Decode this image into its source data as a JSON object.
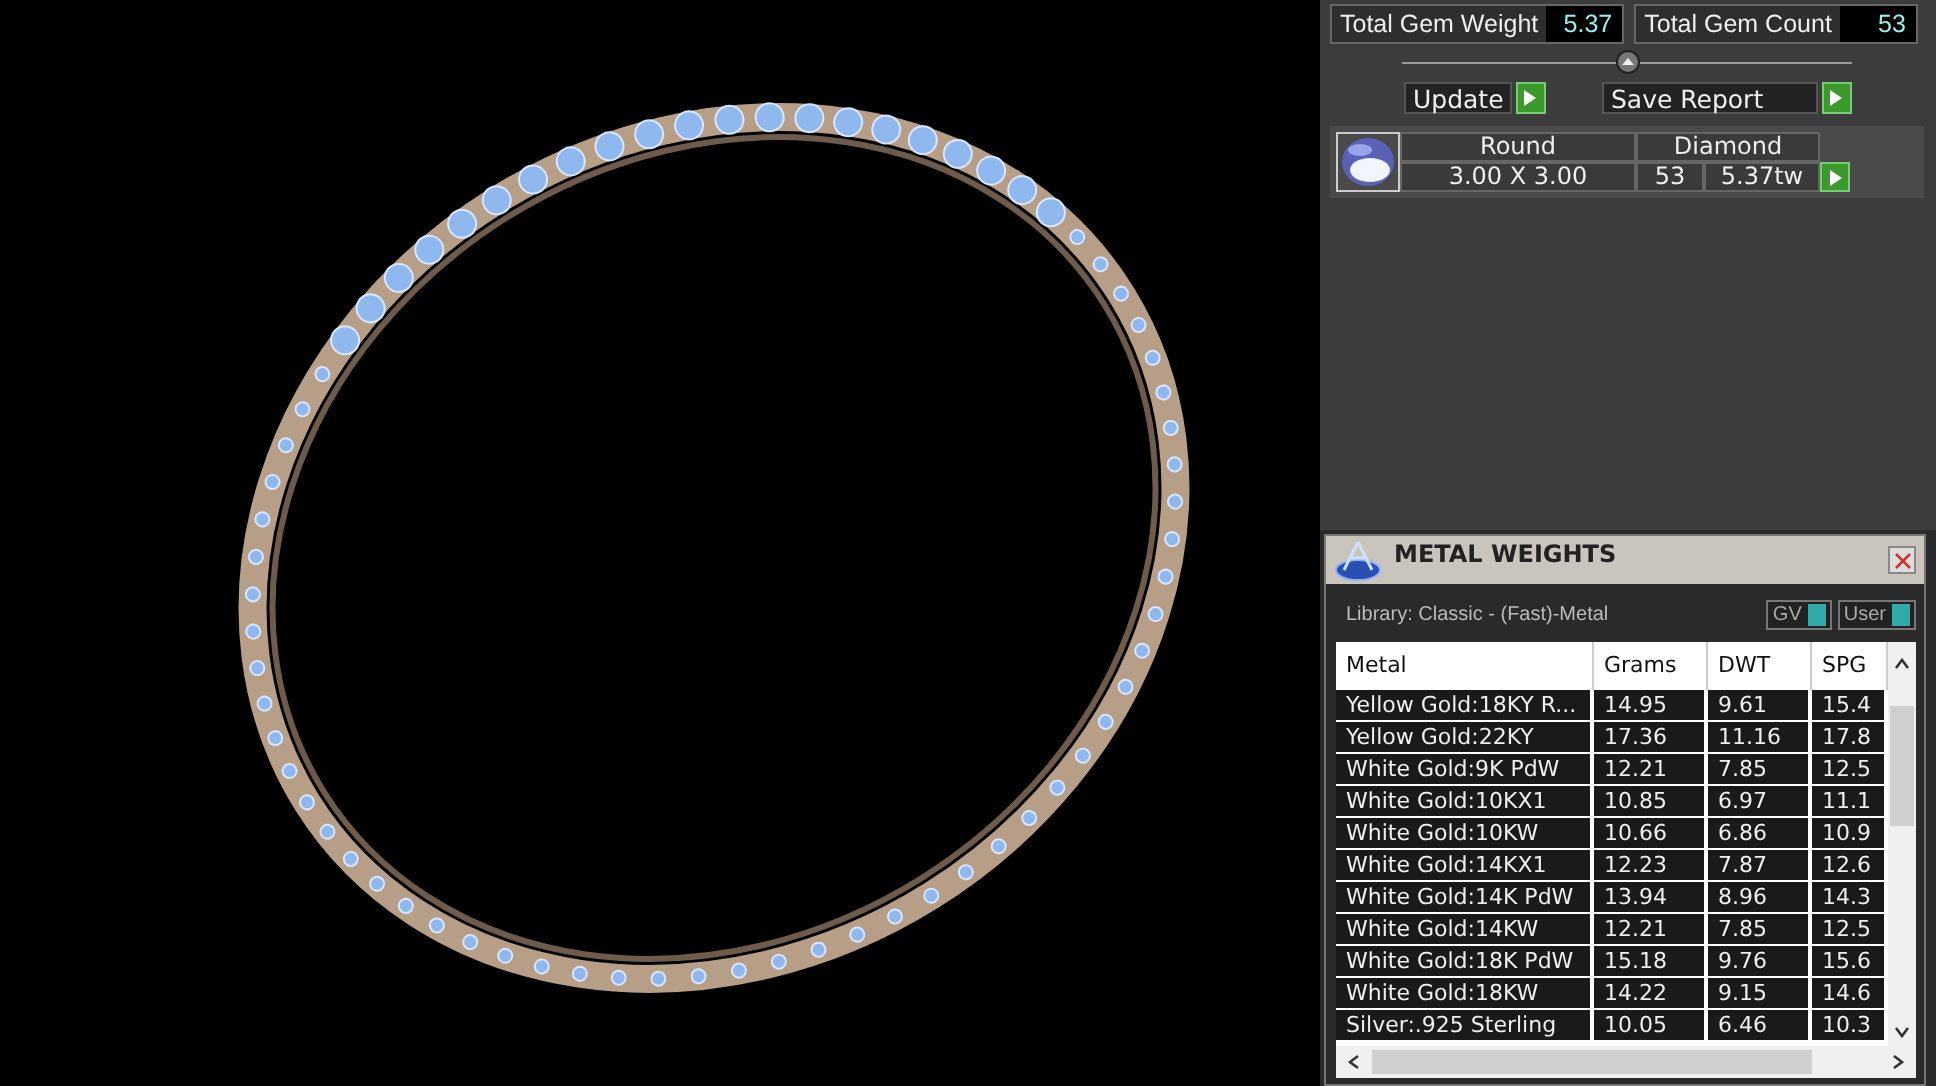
{
  "summary": [
    {
      "label": "Total Gem Weight",
      "value": "5.37"
    },
    {
      "label": "Total Gem Count",
      "value": "53"
    }
  ],
  "buttons": [
    {
      "label": "Update"
    },
    {
      "label": "Save Report"
    }
  ],
  "gem": {
    "shape": "Round",
    "type": "Diamond",
    "size": "3.00 X 3.00",
    "count": "53",
    "weight": "5.37tw"
  },
  "metal_weights": {
    "title": "METAL WEIGHTS",
    "library": "Library: Classic - (Fast)-Metal",
    "toggles": [
      {
        "label": "GV",
        "on": true
      },
      {
        "label": "User",
        "on": true
      }
    ],
    "columns": [
      "Metal",
      "Grams",
      "DWT",
      "SPG"
    ],
    "rows": [
      [
        "Yellow Gold:18KY R...",
        "14.95",
        "9.61",
        "15.4"
      ],
      [
        "Yellow Gold:22KY",
        "17.36",
        "11.16",
        "17.8"
      ],
      [
        "White Gold:9K PdW",
        "12.21",
        "7.85",
        "12.5"
      ],
      [
        "White Gold:10KX1",
        "10.85",
        "6.97",
        "11.1"
      ],
      [
        "White Gold:10KW",
        "10.66",
        "6.86",
        "10.9"
      ],
      [
        "White Gold:14KX1",
        "12.23",
        "7.87",
        "12.6"
      ],
      [
        "White Gold:14K PdW",
        "13.94",
        "8.96",
        "14.3"
      ],
      [
        "White Gold:14KW",
        "12.21",
        "7.85",
        "12.5"
      ],
      [
        "White Gold:18K PdW",
        "15.18",
        "9.76",
        "15.6"
      ],
      [
        "White Gold:18KW",
        "14.22",
        "9.15",
        "14.6"
      ],
      [
        "Silver:.925 Sterling",
        "10.05",
        "6.46",
        "10.3"
      ]
    ]
  }
}
